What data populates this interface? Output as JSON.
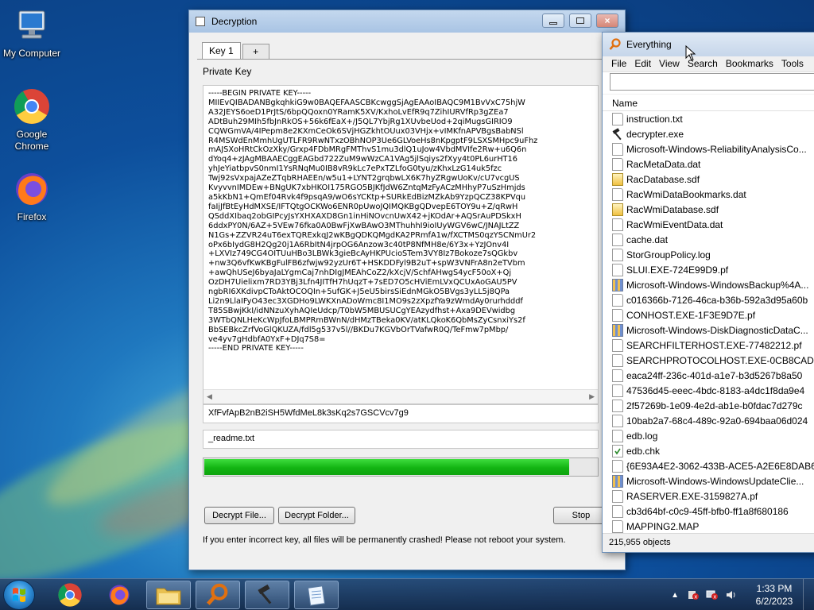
{
  "desktop": {
    "icons": [
      {
        "label": "My Computer"
      },
      {
        "label": "Google Chrome"
      },
      {
        "label": "Firefox"
      }
    ]
  },
  "decryption_window": {
    "title": "Decryption",
    "tabs": [
      {
        "label": "Key 1"
      },
      {
        "label": "+"
      }
    ],
    "private_key_label": "Private Key",
    "private_key_text": "-----BEGIN PRIVATE KEY-----\nMIIEvQIBADANBgkqhkiG9w0BAQEFAASCBKcwggSjAgEAAoIBAQC9M1BvVxC75hjW\nA32JEYS6oeD1PrJtS/6bpQQoxn0YRamK5XV/KxhoLvEfR9q7ZihIURVfRp3gZEa7\nADtBuh29MIh5fbJnRkOS+56k6fEaX+/J5QL7YbjRg1XUvbeUod+2qiMugsGIRIO9\nCQWGmVA/4IPepm8e2KXmCeOk6SVjHGZkhtOUux03VHjx+vIMKfnAPVBgsBabNSl\nR4MSWdEnMmhUgUTLFR9RwNTxzOBhNOP3Ue6GLVoeHs8nKpgptF9LSXSMHpc9uFhz\nmAJSXoHRtCkOzXky/Grxp4FDbMRgFMThvS1mu3dlQ1uJow4VbdMVIfe2Rw+u6Q6n\ndYoq4+zJAgMBAAECggEAGbd722ZuM9wWzCA1VAg5jlSqiys2fXyy4t0PL6urHT16\nyhJeYiatbpvS0nmI1YsRNqMu0IB8vR9kLc7ePxTZLfoG0tyu/zKhxLzG14uk5fzc\nTwj92sVxpajAZeZTqbRHAEEn/w5u1+LYNT2grqbwLX6K7hyZRgwUoKv/cU7vcgUS\nKvyvvnIMDEw+BNgUK7xbHKOI175RGO5BJKfJdW6ZntqMzFyACzMHhyP7uSzHmjds\na5kKbN1+QmEf04Rvk4f9psqA9/wO6sYCKtp+SURkEdBizMZkAb9YzpQCZ38KPVqu\nfaIjJfBtEyHdMXSE/IFTQtgOCKWo6ENR0pUwoJQIMQKBgQDvepE6TOY9u+Z/qRwH\nQSddXIbaq2obGIPcyJsYXHXAXD8Gn1inHiNOvcnUwX42+jKOdAr+AQSrAuPDSkxH\n6ddxPY0N/6AZ+5VEw76fka0A0BwFjXwBAwO3MThuhhI9ioIUyWGV6wC/JNAJLtZZ\nN1Gs+ZZVR24uT6exTQRExkqJ2wKBgQDKQMgdKA2PRmfA1w/fXCTMS0qzYSCNmUr2\noPx6bIydG8H2Qg20j1A6RbItN4jrpOG6Anzow3c40tP8NfMH8e/6Y3x+YzJOnv4I\n+LXVIz749CG4OITUuHBo3LBWk3gieBcAyHKPUcioSTem3VY8Iz7Bokoze7sQGkbv\n+nw3Q6vfKwKBgFulFB6zfwjw92yzUr6T+HSKDDFyl9B2uT+spW3VNFrA8n2eTVbm\n+awQhUSeJ6byaJaLYgmCaj7nhDIgJMEAhCoZ2/kXcjV/SchfAHwgS4ycF50oX+Qj\nOzDH7Uielixm7RD3YBj3Lfn4JITfH7hUqzT+7sED7O5cHViEmLVxQCUxAoGAU5PV\nngbRI6XKdivpCToAktOCOQIn+5ufGK+J5eU5birsSiEdnMGkO5BVgs3yLL5j8QPa\nLi2n9LlaIFyO43ec3XGDHo9LWKXnADoWmc8I1MO9s2zXpzfYa9zWmdAy0rurhdddf\nT85SBwjKkI/idNNzuXyhAQIeUdcp/T0bW5MBUSUCgYEAzydfhst+Axa9DEVwidbg\n3WTbQNLHeKcWpJfoLBMPRmBWnN/dHMzTBeka0KV/atKLQkoK6QbMsZyCsnxiYs2f\nBbSEBkcZrfVoGlQKUZA/fdl5g537v5l//BKDu7KGVbOrTVafwR0Q/TeFmw7pMbp/\nve4yv7gHdbfA0YxF+DJq7S8=\n-----END PRIVATE KEY-----",
    "key_id_value": "XfFvfApB2nB2iSH5WfdMeL8k3sKq2s7GSCVcv7g9",
    "readme_value": "_readme.txt",
    "progress_percent": 93,
    "buttons": {
      "decrypt_file": "Decrypt File...",
      "decrypt_folder": "Decrypt Folder...",
      "stop": "Stop"
    },
    "warning_text": "If you enter incorrect key, all files will be permanently crashed! Please not reboot your system."
  },
  "everything_window": {
    "title": "Everything",
    "menu": [
      "File",
      "Edit",
      "View",
      "Search",
      "Bookmarks",
      "Tools"
    ],
    "search_value": "",
    "column_header": "Name",
    "files": [
      {
        "name": "instruction.txt",
        "icon": "text-file-icon"
      },
      {
        "name": "decrypter.exe",
        "icon": "hammer-icon"
      },
      {
        "name": "Microsoft-Windows-ReliabilityAnalysisCo...",
        "icon": "text-file-icon"
      },
      {
        "name": "RacMetaData.dat",
        "icon": "text-file-icon"
      },
      {
        "name": "RacDatabase.sdf",
        "icon": "database-icon"
      },
      {
        "name": "RacWmiDataBookmarks.dat",
        "icon": "text-file-icon"
      },
      {
        "name": "RacWmiDatabase.sdf",
        "icon": "database-icon"
      },
      {
        "name": "RacWmiEventData.dat",
        "icon": "text-file-icon"
      },
      {
        "name": "cache.dat",
        "icon": "text-file-icon"
      },
      {
        "name": "StorGroupPolicy.log",
        "icon": "text-file-icon"
      },
      {
        "name": "SLUI.EXE-724E99D9.pf",
        "icon": "text-file-icon"
      },
      {
        "name": "Microsoft-Windows-WindowsBackup%4A...",
        "icon": "package-icon"
      },
      {
        "name": "c016366b-7126-46ca-b36b-592a3d95a60b",
        "icon": "text-file-icon"
      },
      {
        "name": "CONHOST.EXE-1F3E9D7E.pf",
        "icon": "text-file-icon"
      },
      {
        "name": "Microsoft-Windows-DiskDiagnosticDataC...",
        "icon": "package-icon"
      },
      {
        "name": "SEARCHFILTERHOST.EXE-77482212.pf",
        "icon": "text-file-icon"
      },
      {
        "name": "SEARCHPROTOCOLHOST.EXE-0CB8CADE...",
        "icon": "text-file-icon"
      },
      {
        "name": "eaca24ff-236c-401d-a1e7-b3d5267b8a50",
        "icon": "text-file-icon"
      },
      {
        "name": "47536d45-eeec-4bdc-8183-a4dc1f8da9e4",
        "icon": "text-file-icon"
      },
      {
        "name": "2f57269b-1e09-4e2d-ab1e-b0fdac7d279c",
        "icon": "text-file-icon"
      },
      {
        "name": "10bab2a7-68c4-489c-92a0-694baa06d024",
        "icon": "text-file-icon"
      },
      {
        "name": "edb.log",
        "icon": "text-file-icon"
      },
      {
        "name": "edb.chk",
        "icon": "checked-file-icon"
      },
      {
        "name": "{6E93A4E2-3062-433B-ACE5-A2E6E8DAB6...",
        "icon": "text-file-icon"
      },
      {
        "name": "Microsoft-Windows-WindowsUpdateClie...",
        "icon": "package-icon"
      },
      {
        "name": "RASERVER.EXE-3159827A.pf",
        "icon": "text-file-icon"
      },
      {
        "name": "cb3d64bf-c0c9-45ff-bfb0-ff1a8f680186",
        "icon": "text-file-icon"
      },
      {
        "name": "MAPPING2.MAP",
        "icon": "text-file-icon"
      }
    ],
    "status_text": "215,955 objects"
  },
  "taskbar": {
    "items": [
      "chrome-icon",
      "firefox-icon",
      "folder-icon",
      "everything-search-icon",
      "hammer-icon",
      "notepad-icon"
    ],
    "time": "1:33 PM",
    "date": "6/2/2023"
  }
}
